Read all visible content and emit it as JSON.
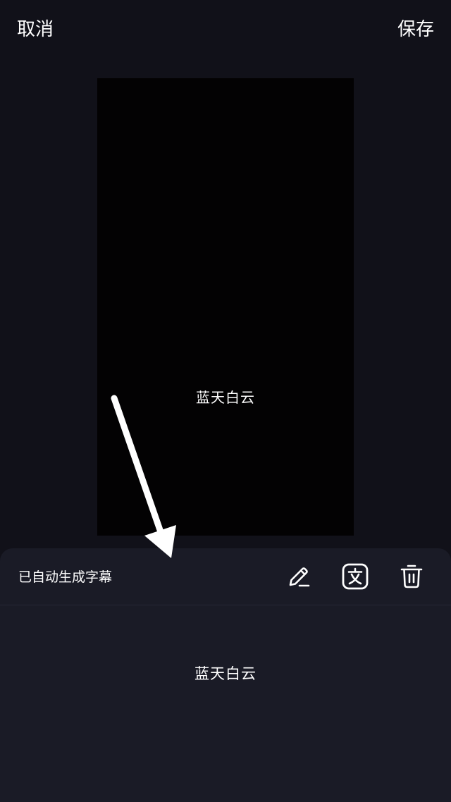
{
  "topbar": {
    "cancel_label": "取消",
    "save_label": "保存"
  },
  "preview": {
    "caption": "蓝天白云"
  },
  "panel": {
    "status": "已自动生成字幕",
    "icons": [
      "edit-pencil-icon",
      "translate-text-icon",
      "trash-icon"
    ],
    "subtitles": [
      "蓝天白云"
    ]
  },
  "colors": {
    "background": "#111119",
    "preview_bg": "#030203",
    "panel_bg": "#1a1b26",
    "text": "#ffffff"
  }
}
